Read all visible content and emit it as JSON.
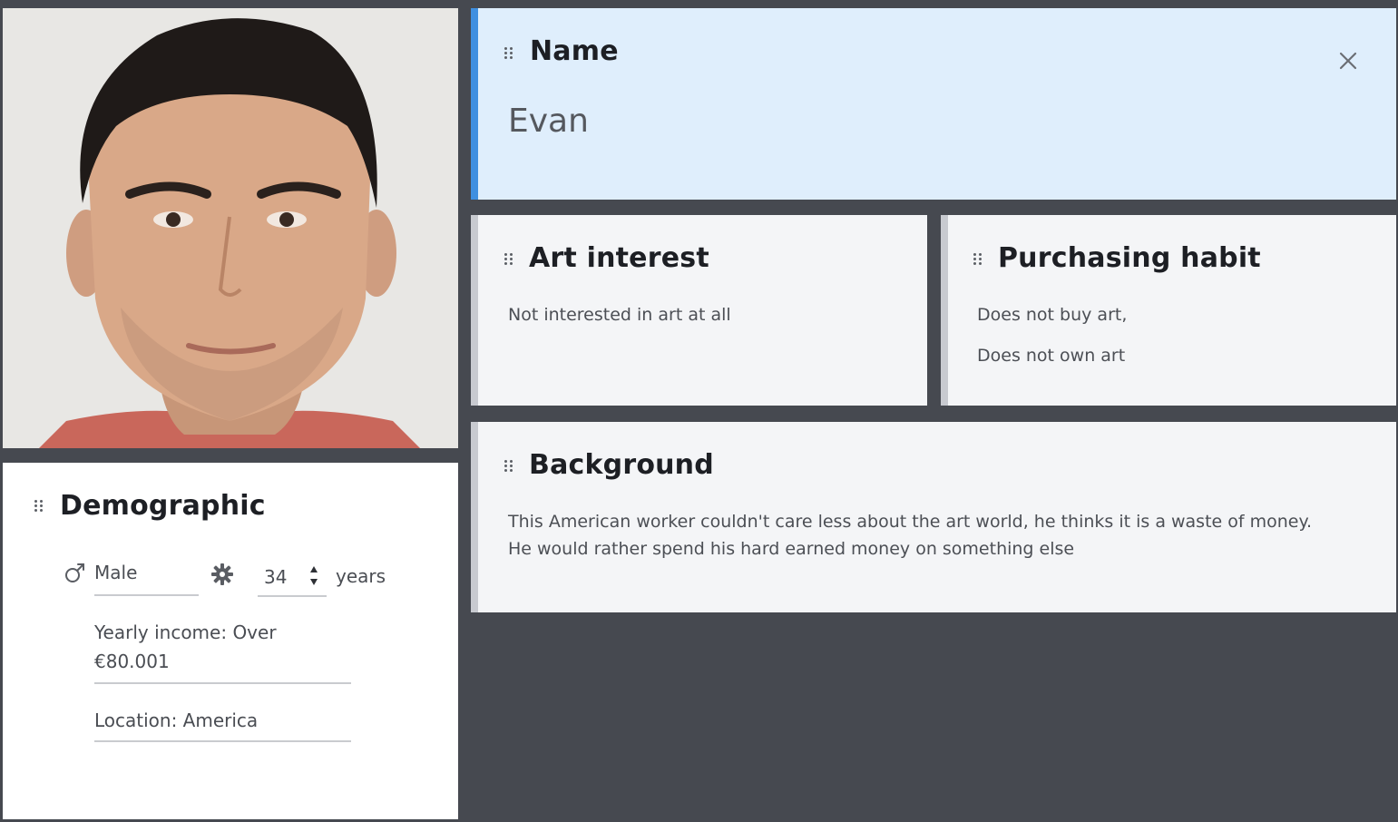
{
  "profile_photo": {
    "alt": ""
  },
  "name_card": {
    "title": "Name",
    "value": "Evan"
  },
  "art_interest": {
    "title": "Art interest",
    "text": "Not interested in art at all"
  },
  "purchasing_habit": {
    "title": "Purchasing habit",
    "lines": [
      "Does not buy art,",
      "Does not own art"
    ]
  },
  "background": {
    "title": "Background",
    "lines": [
      "This American worker couldn't care less about the art world, he thinks it is a waste of money.",
      "He would rather spend his hard earned money on something else"
    ]
  },
  "demographic": {
    "title": "Demographic",
    "gender": "Male",
    "gender_icon": "male-symbol-icon",
    "age": "34",
    "age_unit": "years",
    "income_lines": [
      "Yearly income: Over",
      "€80.001"
    ],
    "location": "Location: America"
  },
  "colors": {
    "background": "#464950",
    "card": "#f4f5f7",
    "selected_card": "#dfeefc",
    "selected_accent": "#3f8fe0"
  }
}
